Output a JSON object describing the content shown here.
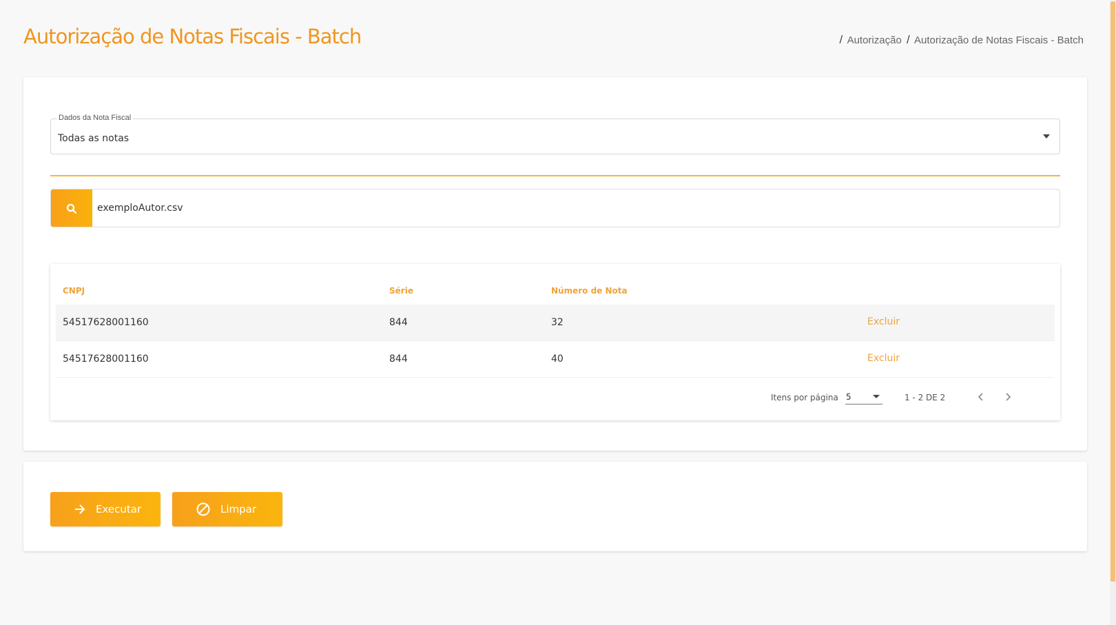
{
  "header": {
    "title": "Autorização de Notas Fiscais - Batch",
    "breadcrumb": [
      "Autorização",
      "Autorização de Notas Fiscais - Batch"
    ]
  },
  "filter": {
    "label": "Dados da Nota Fiscal",
    "value": "Todas as notas"
  },
  "search": {
    "icon": "search-icon",
    "value": "exemploAutor.csv"
  },
  "table": {
    "columns": [
      "CNPJ",
      "Série",
      "Número de Nota"
    ],
    "rows": [
      {
        "cnpj": "54517628001160",
        "serie": "844",
        "numero": "32",
        "action": "Excluir"
      },
      {
        "cnpj": "54517628001160",
        "serie": "844",
        "numero": "40",
        "action": "Excluir"
      }
    ],
    "paginator": {
      "items_label": "Itens por página",
      "page_size": "5",
      "range": "1 - 2 DE 2"
    }
  },
  "actions": {
    "execute_label": "Executar",
    "clear_label": "Limpar"
  },
  "colors": {
    "accent": "#f0951c",
    "button": "#f9a814"
  }
}
